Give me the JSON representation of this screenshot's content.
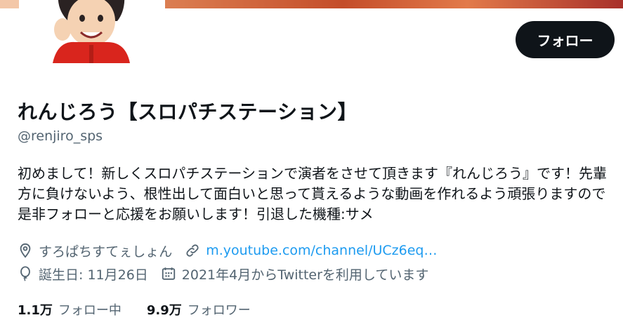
{
  "profile": {
    "display_name": "れんじろう【スロパチステーション】",
    "handle": "@renjiro_sps",
    "bio": "初めまして！新しくスロパチステーションで演者をさせて頂きます『れんじろう』です！先輩方に負けないよう、根性出して面白いと思って貰えるような動画を作れるよう頑張りますので是非フォローと応援をお願いします！引退した機種:サメ",
    "location": "すろぱちすてぇしょん",
    "website": "m.youtube.com/channel/UCz6eq…",
    "birthday": "誕生日: 11月26日",
    "joined": "2021年4月からTwitterを利用しています"
  },
  "actions": {
    "follow_label": "フォロー"
  },
  "stats": {
    "following_count": "1.1万",
    "following_label": "フォロー中",
    "followers_count": "9.9万",
    "followers_label": "フォロワー"
  },
  "icons": {
    "location": "location-pin-icon",
    "link": "link-icon",
    "birthday": "balloon-icon",
    "joined": "calendar-icon"
  },
  "colors": {
    "text": "#0f1419",
    "secondary": "#536471",
    "link": "#1d9bf0",
    "button_bg": "#0f1419"
  }
}
